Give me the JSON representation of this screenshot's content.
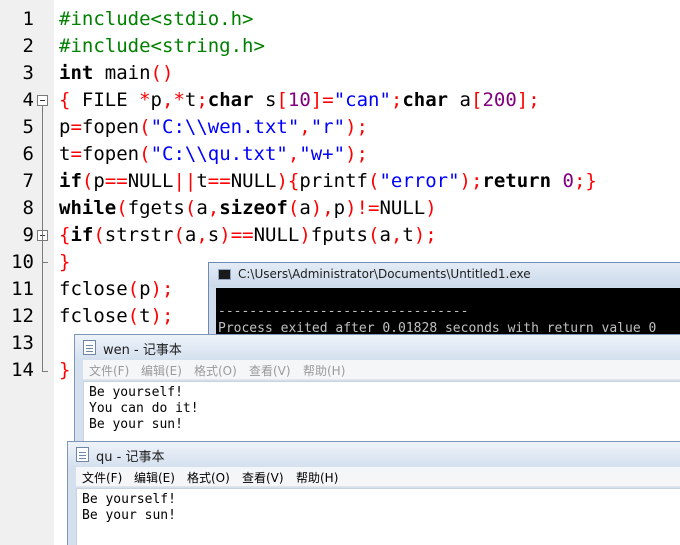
{
  "editor": {
    "lines": [
      {
        "number": "1",
        "tokens": [
          {
            "t": "#include",
            "c": "pp"
          },
          {
            "t": "<stdio.h>",
            "c": "pp"
          }
        ]
      },
      {
        "number": "2",
        "tokens": [
          {
            "t": "#include",
            "c": "pp"
          },
          {
            "t": "<string.h>",
            "c": "pp"
          }
        ]
      },
      {
        "number": "3",
        "tokens": [
          {
            "t": "int",
            "c": "kw"
          },
          {
            "t": " main",
            "c": ""
          },
          {
            "t": "()",
            "c": "sym"
          }
        ]
      },
      {
        "number": "4",
        "tokens": [
          {
            "t": "{",
            "c": "sym"
          },
          {
            "t": " FILE ",
            "c": ""
          },
          {
            "t": "*",
            "c": "sym"
          },
          {
            "t": "p",
            "c": ""
          },
          {
            "t": ",*",
            "c": "sym"
          },
          {
            "t": "t",
            "c": ""
          },
          {
            "t": ";",
            "c": "sym"
          },
          {
            "t": "char",
            "c": "kw"
          },
          {
            "t": " s",
            "c": ""
          },
          {
            "t": "[",
            "c": "sym"
          },
          {
            "t": "10",
            "c": "num"
          },
          {
            "t": "]=",
            "c": "sym"
          },
          {
            "t": "\"can\"",
            "c": "str"
          },
          {
            "t": ";",
            "c": "sym"
          },
          {
            "t": "char",
            "c": "kw"
          },
          {
            "t": " a",
            "c": ""
          },
          {
            "t": "[",
            "c": "sym"
          },
          {
            "t": "200",
            "c": "num"
          },
          {
            "t": "];",
            "c": "sym"
          }
        ]
      },
      {
        "number": "5",
        "tokens": [
          {
            "t": "p",
            "c": ""
          },
          {
            "t": "=",
            "c": "sym"
          },
          {
            "t": "fopen",
            "c": ""
          },
          {
            "t": "(",
            "c": "sym"
          },
          {
            "t": "\"C:\\\\wen.txt\"",
            "c": "str"
          },
          {
            "t": ",",
            "c": "sym"
          },
          {
            "t": "\"r\"",
            "c": "str"
          },
          {
            "t": ");",
            "c": "sym"
          }
        ]
      },
      {
        "number": "6",
        "tokens": [
          {
            "t": "t",
            "c": ""
          },
          {
            "t": "=",
            "c": "sym"
          },
          {
            "t": "fopen",
            "c": ""
          },
          {
            "t": "(",
            "c": "sym"
          },
          {
            "t": "\"C:\\\\qu.txt\"",
            "c": "str"
          },
          {
            "t": ",",
            "c": "sym"
          },
          {
            "t": "\"w+\"",
            "c": "str"
          },
          {
            "t": ");",
            "c": "sym"
          }
        ]
      },
      {
        "number": "7",
        "tokens": [
          {
            "t": "if",
            "c": "kw"
          },
          {
            "t": "(",
            "c": "sym"
          },
          {
            "t": "p",
            "c": ""
          },
          {
            "t": "==",
            "c": "sym"
          },
          {
            "t": "NULL",
            "c": ""
          },
          {
            "t": "||",
            "c": "sym"
          },
          {
            "t": "t",
            "c": ""
          },
          {
            "t": "==",
            "c": "sym"
          },
          {
            "t": "NULL",
            "c": ""
          },
          {
            "t": "){",
            "c": "sym"
          },
          {
            "t": "printf",
            "c": ""
          },
          {
            "t": "(",
            "c": "sym"
          },
          {
            "t": "\"error\"",
            "c": "str"
          },
          {
            "t": ");",
            "c": "sym"
          },
          {
            "t": "return",
            "c": "kw"
          },
          {
            "t": " ",
            "c": ""
          },
          {
            "t": "0",
            "c": "num"
          },
          {
            "t": ";}",
            "c": "sym"
          }
        ]
      },
      {
        "number": "8",
        "tokens": [
          {
            "t": "while",
            "c": "kw"
          },
          {
            "t": "(",
            "c": "sym"
          },
          {
            "t": "fgets",
            "c": ""
          },
          {
            "t": "(",
            "c": "sym"
          },
          {
            "t": "a",
            "c": ""
          },
          {
            "t": ",",
            "c": "sym"
          },
          {
            "t": "sizeof",
            "c": "kw"
          },
          {
            "t": "(",
            "c": "sym"
          },
          {
            "t": "a",
            "c": ""
          },
          {
            "t": "),",
            "c": "sym"
          },
          {
            "t": "p",
            "c": ""
          },
          {
            "t": ")!=",
            "c": "sym"
          },
          {
            "t": "NULL",
            "c": ""
          },
          {
            "t": ")",
            "c": "sym"
          }
        ]
      },
      {
        "number": "9",
        "tokens": [
          {
            "t": "{",
            "c": "sym"
          },
          {
            "t": "if",
            "c": "kw"
          },
          {
            "t": "(",
            "c": "sym"
          },
          {
            "t": "strstr",
            "c": ""
          },
          {
            "t": "(",
            "c": "sym"
          },
          {
            "t": "a",
            "c": ""
          },
          {
            "t": ",",
            "c": "sym"
          },
          {
            "t": "s",
            "c": ""
          },
          {
            "t": ")==",
            "c": "sym"
          },
          {
            "t": "NULL",
            "c": ""
          },
          {
            "t": ")",
            "c": "sym"
          },
          {
            "t": "fputs",
            "c": ""
          },
          {
            "t": "(",
            "c": "sym"
          },
          {
            "t": "a",
            "c": ""
          },
          {
            "t": ",",
            "c": "sym"
          },
          {
            "t": "t",
            "c": ""
          },
          {
            "t": ");",
            "c": "sym"
          }
        ]
      },
      {
        "number": "10",
        "tokens": [
          {
            "t": "}",
            "c": "sym"
          }
        ]
      },
      {
        "number": "11",
        "tokens": [
          {
            "t": "fclose",
            "c": ""
          },
          {
            "t": "(",
            "c": "sym"
          },
          {
            "t": "p",
            "c": ""
          },
          {
            "t": ");",
            "c": "sym"
          }
        ]
      },
      {
        "number": "12",
        "tokens": [
          {
            "t": "fclose",
            "c": ""
          },
          {
            "t": "(",
            "c": "sym"
          },
          {
            "t": "t",
            "c": ""
          },
          {
            "t": ");",
            "c": "sym"
          }
        ]
      },
      {
        "number": "13",
        "tokens": []
      },
      {
        "number": "14",
        "tokens": [
          {
            "t": "}",
            "c": "sym"
          }
        ]
      }
    ]
  },
  "console": {
    "title": "C:\\Users\\Administrator\\Documents\\Untitled1.exe",
    "lines": [
      "--------------------------------",
      "Process exited after 0.01828 seconds with return value 0"
    ]
  },
  "notepad_wen": {
    "title": "wen - 记事本",
    "menu": [
      "文件(F)",
      "编辑(E)",
      "格式(O)",
      "查看(V)",
      "帮助(H)"
    ],
    "lines": [
      "Be yourself!",
      "You can do it!",
      "Be your sun!"
    ]
  },
  "notepad_qu": {
    "title": "qu - 记事本",
    "menu": [
      "文件(F)",
      "编辑(E)",
      "格式(O)",
      "查看(V)",
      "帮助(H)"
    ],
    "lines": [
      "Be yourself!",
      "Be your sun!"
    ]
  },
  "colors": {
    "keyword": "#000000",
    "preprocessor": "#008000",
    "string": "#0000ff",
    "number": "#800080",
    "symbol": "#ff0000",
    "gutter": "#f0f0f0"
  }
}
